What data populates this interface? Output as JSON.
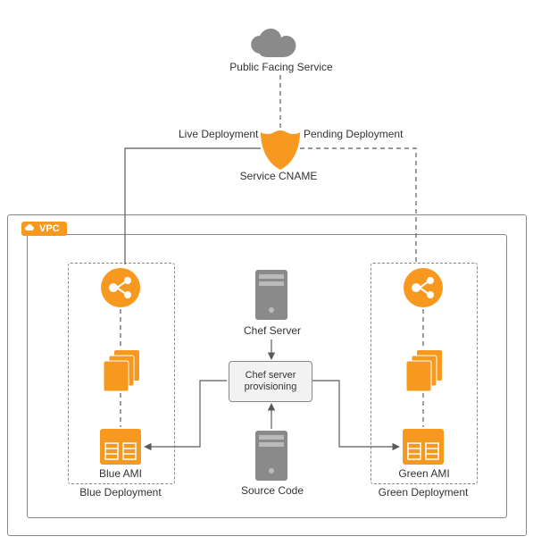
{
  "top": {
    "cloud_label": "Public Facing Service",
    "shield_label": "Service CNAME",
    "left_edge_label": "Live Deployment",
    "right_edge_label": "Pending Deployment"
  },
  "vpc": {
    "badge": "VPC",
    "blue": {
      "group_label": "Blue Deployment",
      "ami_label": "Blue AMI"
    },
    "green": {
      "group_label": "Green Deployment",
      "ami_label": "Green AMI"
    },
    "center": {
      "chef_server_label": "Chef Server",
      "provisioning_label": "Chef server provisioning",
      "source_code_label": "Source Code"
    }
  },
  "colors": {
    "accent_orange": "#f7981f",
    "neutral_gray": "#8a8a8a",
    "line": "#5a5a5a"
  },
  "chart_data": {
    "type": "table",
    "title": "Blue/Green Deployment with Chef Provisioning inside a VPC",
    "nodes": [
      {
        "id": "public",
        "label": "Public Facing Service",
        "kind": "cloud"
      },
      {
        "id": "cname",
        "label": "Service CNAME",
        "kind": "shield"
      },
      {
        "id": "vpc",
        "label": "VPC",
        "kind": "container"
      },
      {
        "id": "blue_dep",
        "label": "Blue Deployment",
        "kind": "group",
        "parent": "vpc"
      },
      {
        "id": "green_dep",
        "label": "Green Deployment",
        "kind": "group",
        "parent": "vpc"
      },
      {
        "id": "blue_lb",
        "label": "Load Balancer",
        "kind": "elb-icon",
        "parent": "blue_dep"
      },
      {
        "id": "blue_stack",
        "label": "Instances",
        "kind": "stack-icon",
        "parent": "blue_dep"
      },
      {
        "id": "blue_ami",
        "label": "Blue AMI",
        "kind": "ami-icon",
        "parent": "blue_dep"
      },
      {
        "id": "green_lb",
        "label": "Load Balancer",
        "kind": "elb-icon",
        "parent": "green_dep"
      },
      {
        "id": "green_stack",
        "label": "Instances",
        "kind": "stack-icon",
        "parent": "green_dep"
      },
      {
        "id": "green_ami",
        "label": "Green AMI",
        "kind": "ami-icon",
        "parent": "green_dep"
      },
      {
        "id": "chef",
        "label": "Chef Server",
        "kind": "server-icon",
        "parent": "vpc"
      },
      {
        "id": "prov",
        "label": "Chef server provisioning",
        "kind": "process-box",
        "parent": "vpc"
      },
      {
        "id": "src",
        "label": "Source Code",
        "kind": "server-icon",
        "parent": "vpc"
      }
    ],
    "edges": [
      {
        "from": "public",
        "to": "cname",
        "style": "dashed",
        "directed": false
      },
      {
        "from": "cname",
        "to": "blue_lb",
        "label": "Live Deployment",
        "style": "solid",
        "directed": false
      },
      {
        "from": "cname",
        "to": "green_lb",
        "label": "Pending Deployment",
        "style": "dashed",
        "directed": false
      },
      {
        "from": "blue_lb",
        "to": "blue_stack",
        "style": "dashed",
        "directed": false
      },
      {
        "from": "blue_stack",
        "to": "blue_ami",
        "style": "dashed",
        "directed": false
      },
      {
        "from": "green_lb",
        "to": "green_stack",
        "style": "dashed",
        "directed": false
      },
      {
        "from": "green_stack",
        "to": "green_ami",
        "style": "dashed",
        "directed": false
      },
      {
        "from": "chef",
        "to": "prov",
        "style": "solid",
        "directed": true
      },
      {
        "from": "src",
        "to": "prov",
        "style": "solid",
        "directed": true
      },
      {
        "from": "prov",
        "to": "blue_ami",
        "style": "solid",
        "directed": true
      },
      {
        "from": "prov",
        "to": "green_ami",
        "style": "solid",
        "directed": true
      }
    ]
  }
}
